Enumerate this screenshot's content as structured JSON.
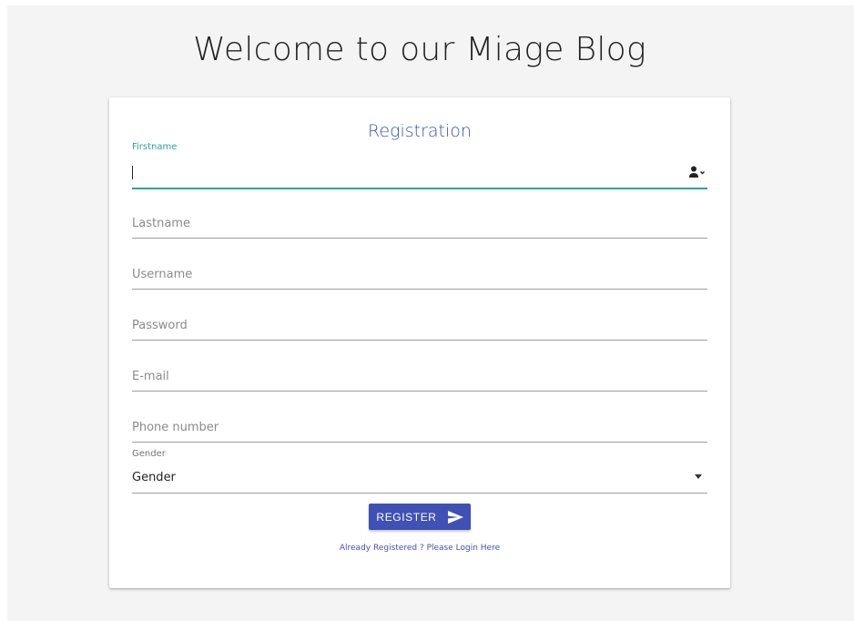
{
  "header": {
    "title": "Welcome to our Miage Blog"
  },
  "form": {
    "title": "Registration",
    "fields": {
      "firstname": {
        "label": "Firstname",
        "value": ""
      },
      "lastname": {
        "placeholder": "Lastname"
      },
      "username": {
        "placeholder": "Username"
      },
      "password": {
        "placeholder": "Password"
      },
      "email": {
        "placeholder": "E-mail"
      },
      "phone": {
        "placeholder": "Phone number"
      },
      "gender": {
        "label": "Gender",
        "selected": "Gender"
      }
    },
    "register_label": "REGISTER",
    "login_link": "Already Registered ? Please Login Here"
  },
  "icons": {
    "firstname_suffix": "user-icon",
    "register": "send-icon",
    "gender_dropdown": "dropdown-caret-icon"
  },
  "colors": {
    "primary": "#3f51b5",
    "active_field": "#26a69a",
    "background": "#f4f4f4"
  }
}
